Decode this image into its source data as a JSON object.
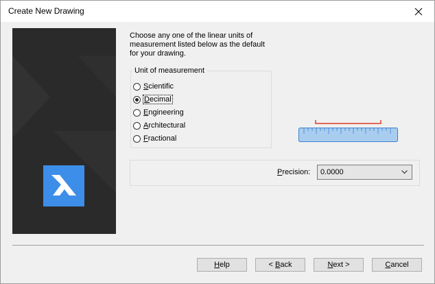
{
  "window": {
    "title": "Create New Drawing"
  },
  "intro": {
    "lines": [
      "Choose any one of the linear units of",
      "measurement listed below as the default",
      "for your drawing."
    ]
  },
  "units": {
    "group_label": "Unit of measurement",
    "options": [
      {
        "label": "Scientific",
        "mnemonic": "S",
        "rest": "cientific",
        "checked": false
      },
      {
        "label": "Decimal",
        "mnemonic": "D",
        "rest": "ecimal",
        "checked": true
      },
      {
        "label": "Engineering",
        "mnemonic": "E",
        "rest": "ngineering",
        "checked": false
      },
      {
        "label": "Architectural",
        "mnemonic": "A",
        "rest": "rchitectural",
        "checked": false
      },
      {
        "label": "Fractional",
        "mnemonic": "F",
        "rest": "ractional",
        "checked": false
      }
    ]
  },
  "precision": {
    "label_mnemonic": "P",
    "label_rest": "recision:",
    "value": "0.0000"
  },
  "buttons": {
    "help": {
      "mnemonic": "H",
      "rest": "elp"
    },
    "back": {
      "prefix": "< ",
      "mnemonic": "B",
      "rest": "ack"
    },
    "next": {
      "mnemonic": "N",
      "rest": "ext >"
    },
    "cancel": {
      "mnemonic": "C",
      "rest": "ancel"
    }
  },
  "colors": {
    "side_panel": "#2a2a2a",
    "logo": "#3d8ee8",
    "ruler_fill": "#a9cdef",
    "ruler_stroke": "#3b7fd1",
    "measure_line": "#e03c20"
  }
}
